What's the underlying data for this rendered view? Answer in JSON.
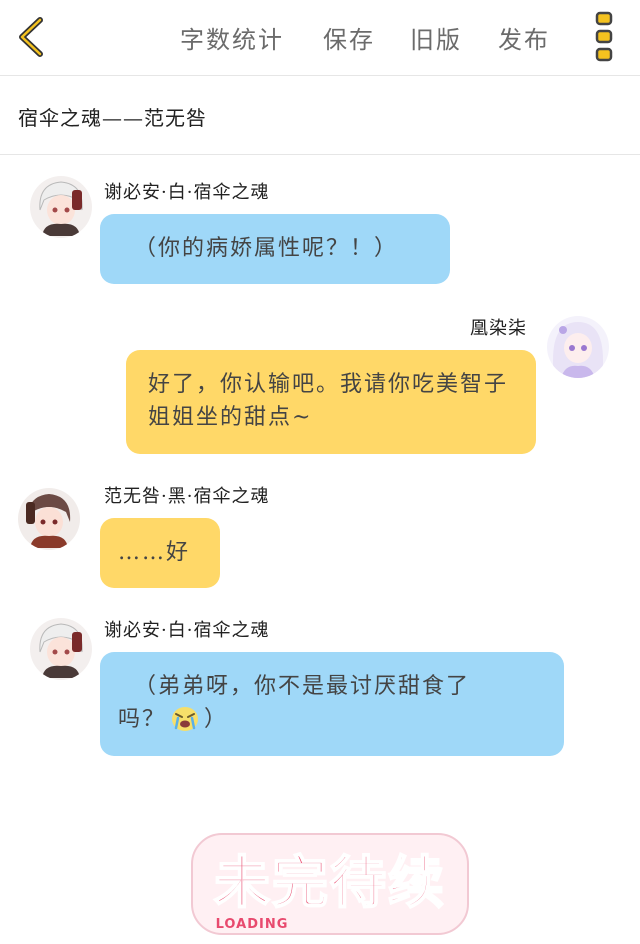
{
  "toolbar": {
    "word_count": "字数统计",
    "save": "保存",
    "old_version": "旧版",
    "publish": "发布",
    "back_icon": "chevron-left-icon",
    "menu_icon": "vertical-dots-icon",
    "accent_color": "#f4c21f"
  },
  "story": {
    "title": "宿伞之魂——范无咎"
  },
  "messages": [
    {
      "speaker": "谢必安·白·宿伞之魂",
      "side": "left",
      "text": "（你的病娇属性呢？！）",
      "bubble_color": "#9fd8f8"
    },
    {
      "speaker": "凰染柒",
      "side": "right",
      "text": "好了，你认输吧。我请你吃美智子姐姐坐的甜点~",
      "bubble_color": "#ffd868"
    },
    {
      "speaker": "范无咎·黑·宿伞之魂",
      "side": "left",
      "text": "……好",
      "bubble_color": "#ffd868"
    },
    {
      "speaker": "谢必安·白·宿伞之魂",
      "side": "left",
      "text_line1": "（弟弟呀，你不是最讨厌甜食了",
      "text_line2_a": "吗？",
      "emoji": "crying-face-icon",
      "text_line2_b": "）",
      "bubble_color": "#9fd8f8"
    }
  ],
  "footer": {
    "stamp_text": "未完待续",
    "stamp_sub": "LOADING",
    "stamp_color": "#e84a6e"
  }
}
